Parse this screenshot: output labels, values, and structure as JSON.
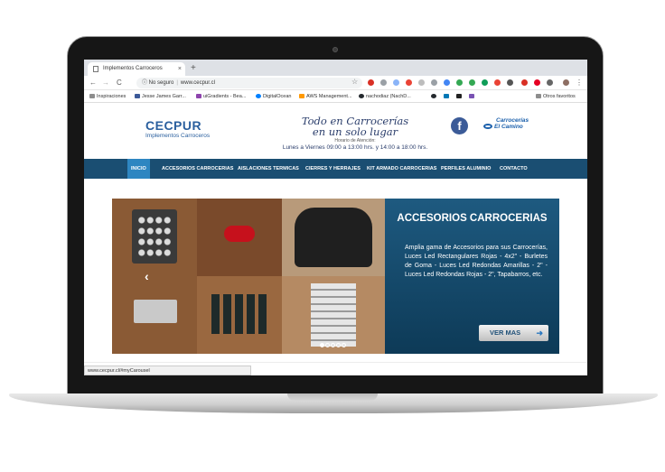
{
  "browser": {
    "tab_title": "Implementos Carroceros",
    "tab_close": "×",
    "new_tab": "+",
    "nav_back": "←",
    "nav_forward": "→",
    "nav_reload": "C",
    "security_label": "No seguro",
    "url": "www.cecpur.cl",
    "status_url": "www.cecpur.cl/#myCarousel"
  },
  "bookmarks": [
    {
      "label": "Inspiraciones"
    },
    {
      "label": "Jesse James Garr..."
    },
    {
      "label": "uiGradients - Bea..."
    },
    {
      "label": "DigitalOcean"
    },
    {
      "label": "AWS Management..."
    },
    {
      "label": "nachodiaz (NachD..."
    },
    {
      "label": "Otros favoritos"
    }
  ],
  "site": {
    "logo_brand": "CECPUR",
    "logo_sub": "Implementos Carroceros",
    "tagline_line1": "Todo en Carrocerías",
    "tagline_line2": "en un solo lugar",
    "hours_label": "Horario de Atención:",
    "hours": "Lunes a Viernes 09:00 a 13:00 hrs. y 14:00 a 18:00 hrs.",
    "facebook_glyph": "f",
    "partner_line1": "Carrocerías",
    "partner_line2": "El Camino"
  },
  "nav": [
    {
      "label": "INICIO",
      "active": true
    },
    {
      "label": "ACCESORIOS CARROCERIAS"
    },
    {
      "label": "AISLACIONES TERMICAS"
    },
    {
      "label": "CIERRES Y HERRAJES"
    },
    {
      "label": "KIT ARMADO CARROCERIAS"
    },
    {
      "label": "PERFILES ALUMINIO"
    },
    {
      "label": "CONTACTO"
    }
  ],
  "carousel": {
    "title": "ACCESORIOS CARROCERIAS",
    "body": "Amplia gama de Accesorios para sus Carrocerías, Luces Led Rectangulares Rojas - 4x2\" - Burletes de Goma - Luces Led Redondas Amarillas - 2\" - Luces Led Redondas Rojas - 2\", Tapabarros, etc.",
    "button_label": "VER MAS",
    "button_arrow": "➜",
    "prev_glyph": "‹",
    "next_glyph": "›",
    "slide_count": 5,
    "active_slide": 1
  }
}
